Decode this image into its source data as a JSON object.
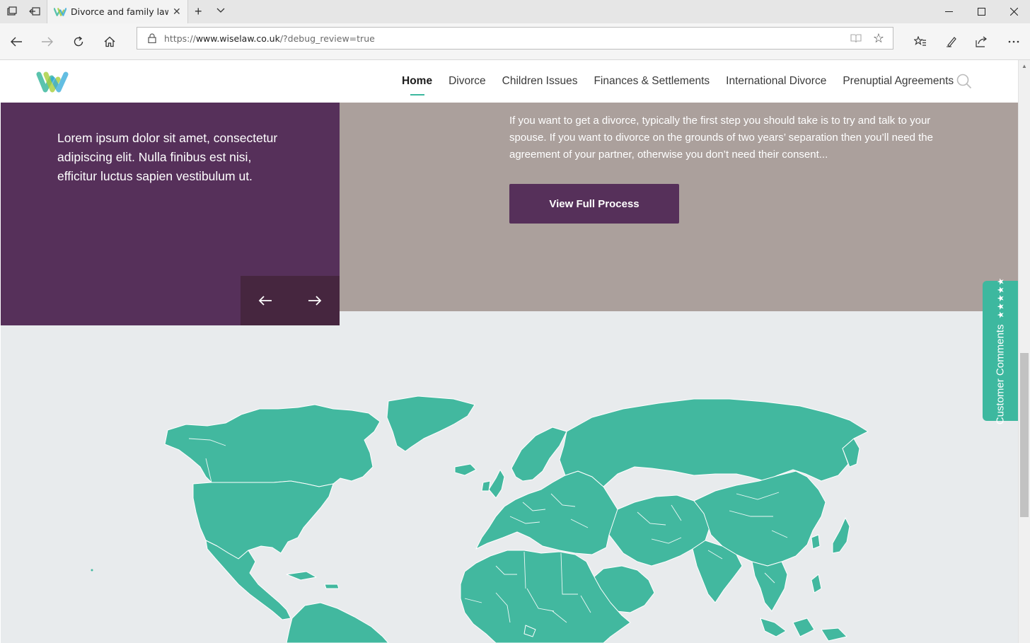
{
  "browser": {
    "tab_title": "Divorce and family law a",
    "url_prefix": "https://",
    "url_domain": "www.wiselaw.co.uk",
    "url_path": "/?debug_review=true"
  },
  "nav": {
    "items": [
      {
        "label": "Home"
      },
      {
        "label": "Divorce"
      },
      {
        "label": "Children Issues"
      },
      {
        "label": "Finances & Settlements"
      },
      {
        "label": "International Divorce"
      },
      {
        "label": "Prenuptial Agreements"
      }
    ]
  },
  "hero": {
    "body": "Lorem ipsum dolor sit amet, consectetur adipiscing elit. Nulla finibus est nisi, efficitur luctus sapien vestibulum ut."
  },
  "process": {
    "description": "If you want to get a divorce, typically the first step you should take is to try and talk to your spouse. If you want to divorce on the grounds of two years’ separation then you’ll need the agreement of your partner, otherwise you don’t need their consent...",
    "button_label": "View Full Process"
  },
  "comments_tab": {
    "label": "Customer Comments",
    "stars": "★★★★★"
  },
  "colors": {
    "brand_purple": "#56305a",
    "accent_teal": "#3db89f",
    "panel_grey": "#aba09c"
  }
}
